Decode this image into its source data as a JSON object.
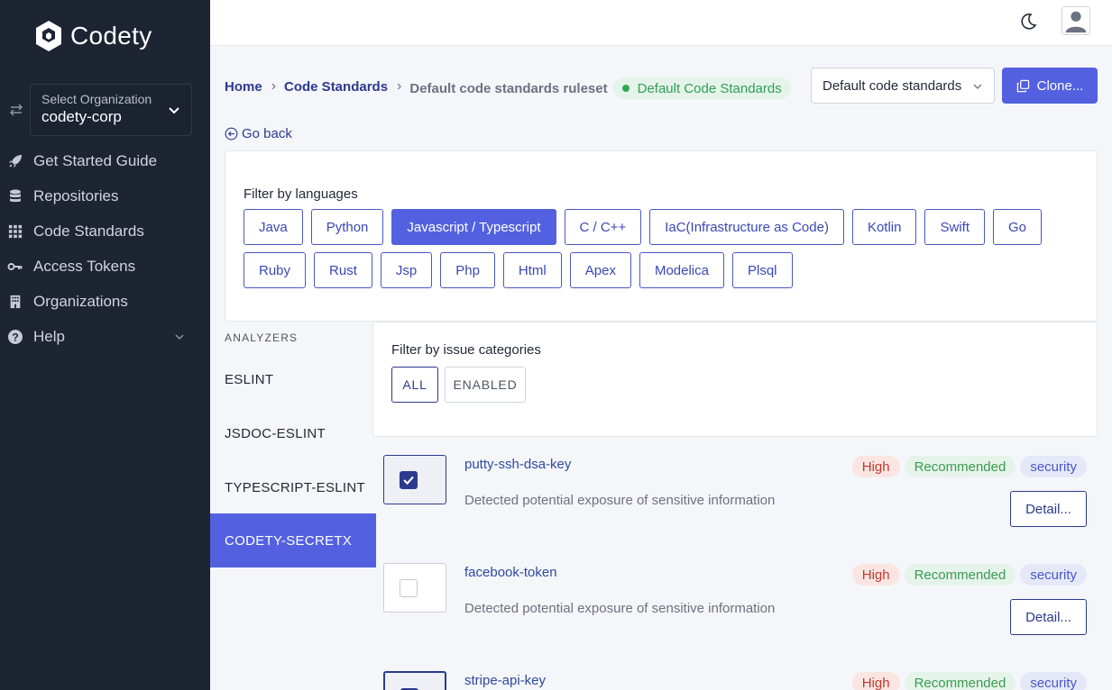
{
  "brand": {
    "name": "Codety"
  },
  "org": {
    "label": "Select Organization",
    "value": "codety-corp"
  },
  "nav": [
    {
      "label": "Get Started Guide",
      "icon": "rocket-icon"
    },
    {
      "label": "Repositories",
      "icon": "database-icon"
    },
    {
      "label": "Code Standards",
      "icon": "grid-icon"
    },
    {
      "label": "Access Tokens",
      "icon": "key-icon"
    },
    {
      "label": "Organizations",
      "icon": "building-icon"
    },
    {
      "label": "Help",
      "icon": "question-icon"
    }
  ],
  "breadcrumb": {
    "home": "Home",
    "standards": "Code Standards",
    "current": "Default code standards ruleset",
    "badge": "Default Code Standards"
  },
  "standard_select": {
    "value": "Default code standards"
  },
  "clone_label": "Clone...",
  "go_back": "Go back",
  "languages": {
    "title": "Filter by languages",
    "row1": [
      "Java",
      "Python",
      "Javascript / Typescript",
      "C / C++",
      "IaC(Infrastructure as Code)",
      "Kotlin",
      "Swift",
      "Go"
    ],
    "row2": [
      "Ruby",
      "Rust",
      "Jsp",
      "Php",
      "Html",
      "Apex",
      "Modelica",
      "Plsql"
    ],
    "active": "Javascript / Typescript"
  },
  "analyzers": {
    "header": "ANALYZERS",
    "items": [
      "ESLINT",
      "JSDOC-ESLINT",
      "TYPESCRIPT-ESLINT",
      "CODETY-SECRETX"
    ],
    "active": "CODETY-SECRETX"
  },
  "categories": {
    "title": "Filter by issue categories",
    "all": "ALL",
    "enabled": "ENABLED"
  },
  "rules": [
    {
      "name": "putty-ssh-dsa-key",
      "desc": "Detected potential exposure of sensitive information",
      "checked": true,
      "severity": "High",
      "recommended": "Recommended",
      "category": "security",
      "detail": "Detail..."
    },
    {
      "name": "facebook-token",
      "desc": "Detected potential exposure of sensitive information",
      "checked": false,
      "severity": "High",
      "recommended": "Recommended",
      "category": "security",
      "detail": "Detail..."
    },
    {
      "name": "stripe-api-key",
      "desc": "",
      "checked": true,
      "severity": "High",
      "recommended": "Recommended",
      "category": "security",
      "detail": ""
    }
  ],
  "colors": {
    "sidebar": "#1d2432",
    "accent": "#5361e0",
    "link": "#2b3a8c"
  }
}
